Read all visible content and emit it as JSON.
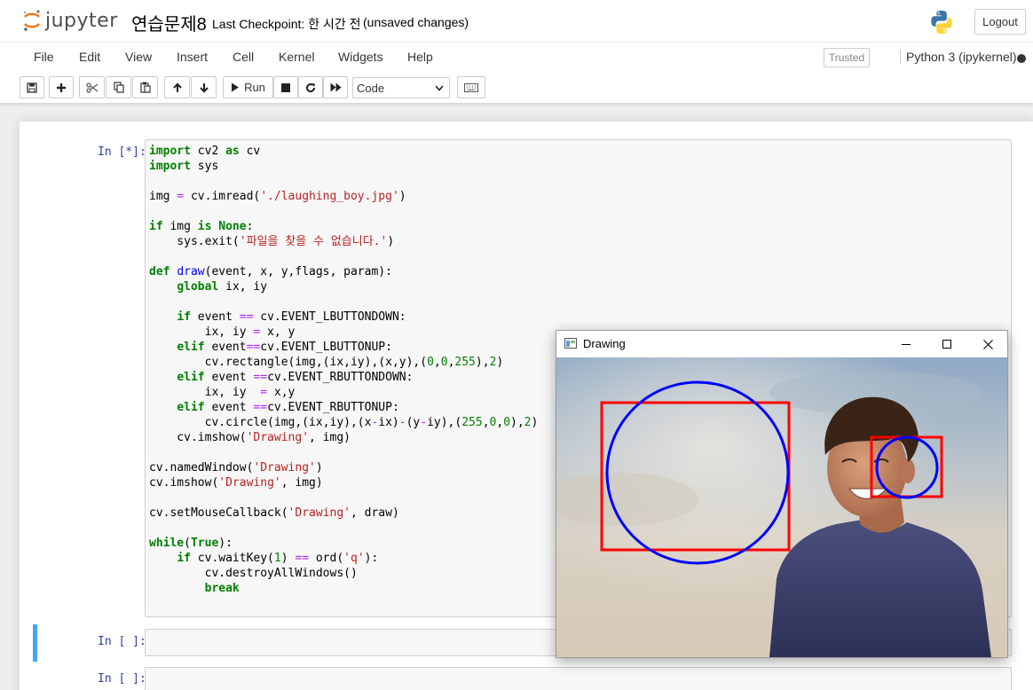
{
  "header": {
    "logo_text": "jupyter",
    "notebook_name": "연습문제8",
    "checkpoint": "Last Checkpoint: 한 시간 전",
    "autosave_status": "(unsaved changes)",
    "logout_label": "Logout"
  },
  "menubar": {
    "items": [
      "File",
      "Edit",
      "View",
      "Insert",
      "Cell",
      "Kernel",
      "Widgets",
      "Help"
    ],
    "trusted_label": "Trusted",
    "kernel_name": "Python 3 (ipykernel)"
  },
  "toolbar": {
    "run_label": "Run",
    "cell_type": "Code"
  },
  "cells": [
    {
      "prompt": "In [*]:"
    },
    {
      "prompt": "In [ ]:"
    },
    {
      "prompt": "In [ ]:"
    }
  ],
  "drawing_window": {
    "title": "Drawing"
  },
  "colors": {
    "prompt": "#303f9f",
    "selected_cell_bar": "#42a5f5",
    "keyword": "#008000",
    "string": "#ba2121",
    "rect": "#ff0000",
    "circle": "#0000ff"
  }
}
